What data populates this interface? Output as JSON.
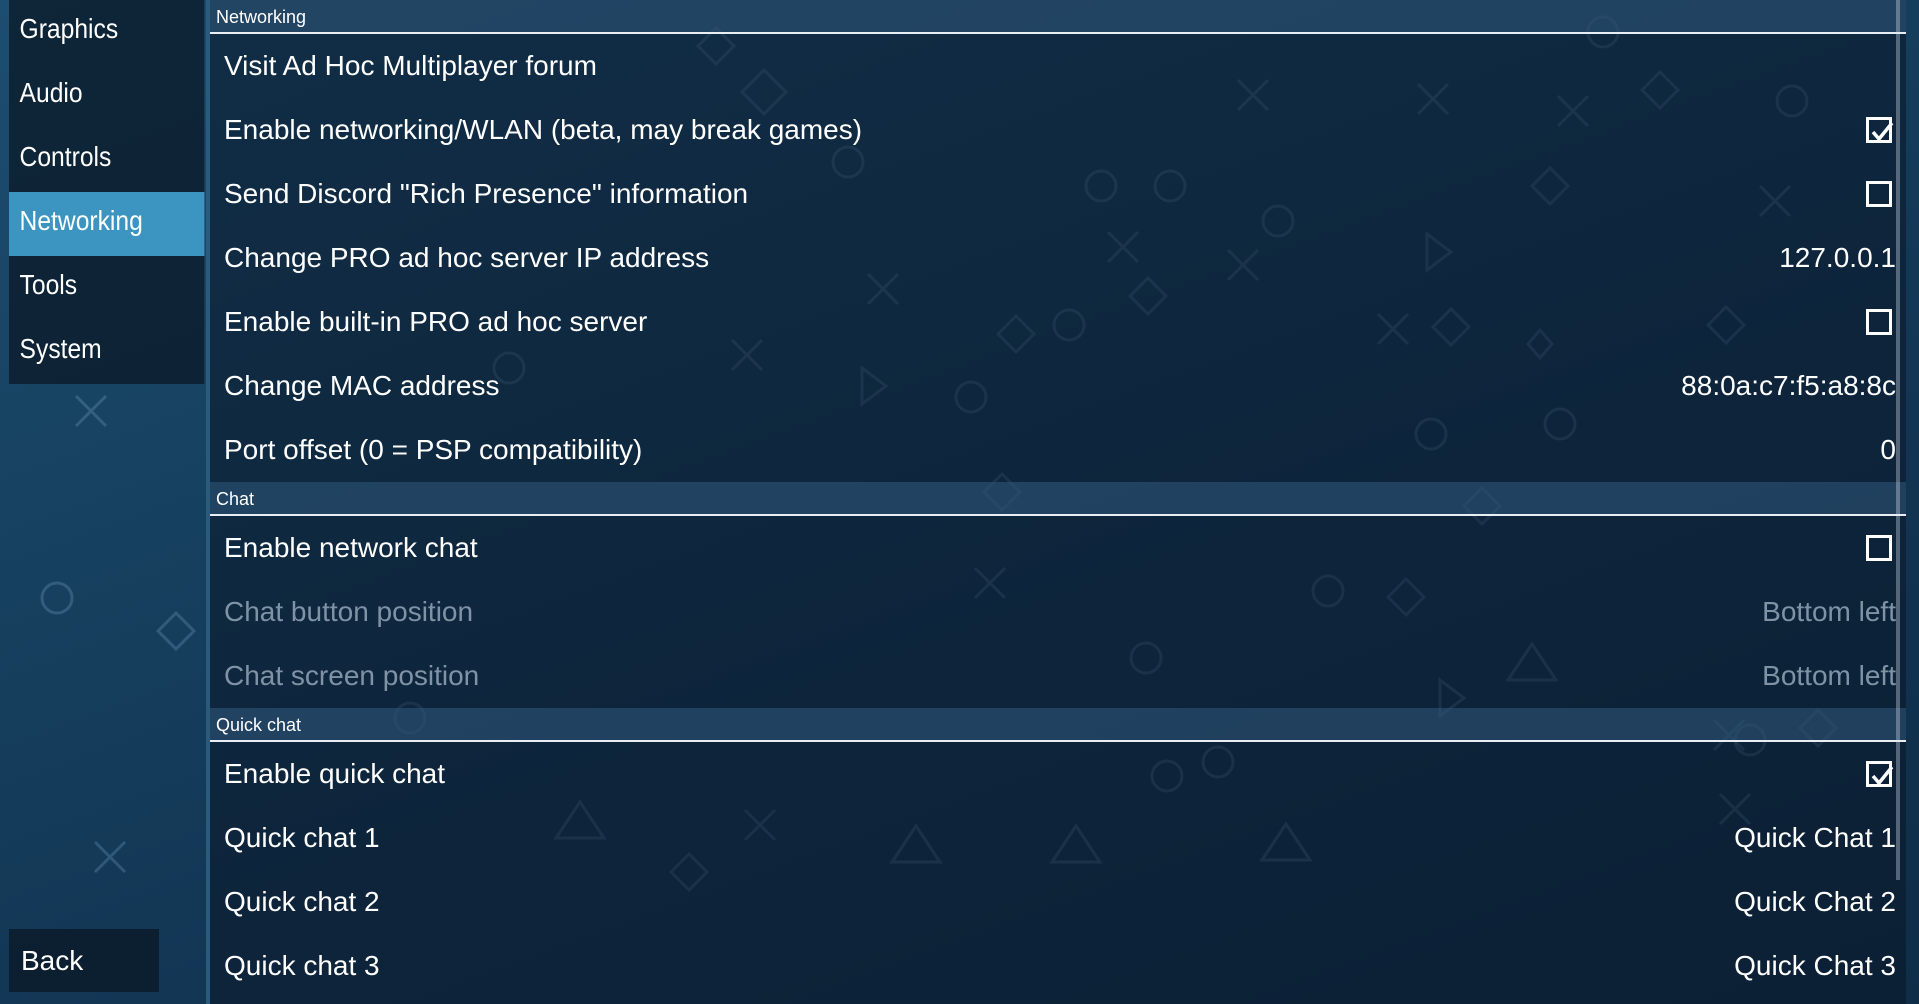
{
  "sidebar": {
    "items": [
      {
        "label": "Graphics"
      },
      {
        "label": "Audio"
      },
      {
        "label": "Controls"
      },
      {
        "label": "Networking"
      },
      {
        "label": "Tools"
      },
      {
        "label": "System"
      }
    ],
    "selected": "Networking",
    "back_label": "Back"
  },
  "sections": {
    "networking": {
      "header": "Networking",
      "visit_forum": {
        "label": "Visit Ad Hoc Multiplayer forum"
      },
      "enable_wlan": {
        "label": "Enable networking/WLAN (beta, may break games)",
        "checked": true
      },
      "discord": {
        "label": "Send Discord \"Rich Presence\" information",
        "checked": false
      },
      "server_ip": {
        "label": "Change PRO ad hoc server IP address",
        "value": "127.0.0.1"
      },
      "builtin_server": {
        "label": "Enable built-in PRO ad hoc server",
        "checked": false
      },
      "mac": {
        "label": "Change MAC address",
        "value": "88:0a:c7:f5:a8:8c"
      },
      "port_offset": {
        "label": "Port offset (0 = PSP compatibility)",
        "value": "0"
      }
    },
    "chat": {
      "header": "Chat",
      "enable_chat": {
        "label": "Enable network chat",
        "checked": false
      },
      "button_position": {
        "label": "Chat button position",
        "value": "Bottom left"
      },
      "screen_position": {
        "label": "Chat screen position",
        "value": "Bottom left"
      }
    },
    "quick_chat": {
      "header": "Quick chat",
      "enable_quick": {
        "label": "Enable quick chat",
        "checked": true
      },
      "qc1": {
        "label": "Quick chat 1",
        "value": "Quick Chat 1"
      },
      "qc2": {
        "label": "Quick chat 2",
        "value": "Quick Chat 2"
      },
      "qc3": {
        "label": "Quick chat 3",
        "value": "Quick Chat 3"
      }
    }
  },
  "colors": {
    "accent": "#3b95c0",
    "background": "#16405f",
    "disabled_text": "#7f93a5"
  }
}
